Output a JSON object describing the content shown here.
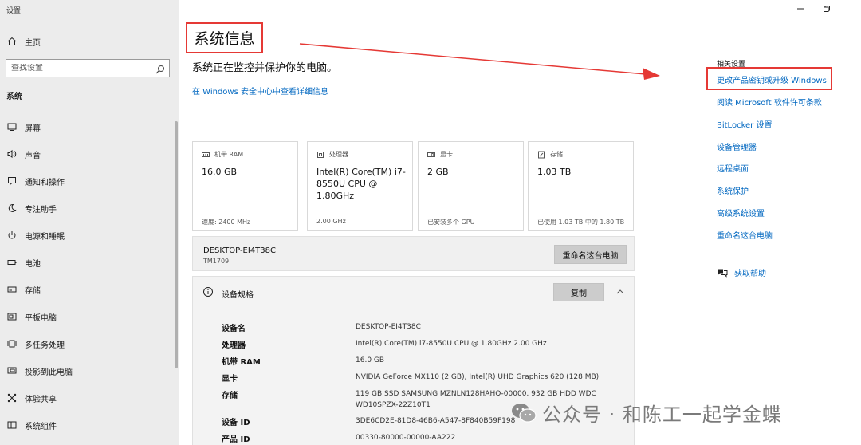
{
  "window": {
    "app_title": "设置",
    "controls": {
      "minimize": "minimize-icon",
      "restore": "restore-icon"
    }
  },
  "sidebar": {
    "home_label": "主页",
    "search_placeholder": "查找设置",
    "section_label": "系统",
    "items": [
      {
        "label": "屏幕",
        "icon": "display-icon"
      },
      {
        "label": "声音",
        "icon": "speaker-icon"
      },
      {
        "label": "通知和操作",
        "icon": "notification-icon"
      },
      {
        "label": "专注助手",
        "icon": "moon-icon"
      },
      {
        "label": "电源和睡眠",
        "icon": "power-icon"
      },
      {
        "label": "电池",
        "icon": "battery-icon"
      },
      {
        "label": "存储",
        "icon": "storage-icon"
      },
      {
        "label": "平板电脑",
        "icon": "tablet-icon"
      },
      {
        "label": "多任务处理",
        "icon": "multitask-icon"
      },
      {
        "label": "投影到此电脑",
        "icon": "project-icon"
      },
      {
        "label": "体验共享",
        "icon": "share-icon"
      },
      {
        "label": "系统组件",
        "icon": "components-icon"
      }
    ]
  },
  "main": {
    "title": "系统信息",
    "subtitle": "系统正在监控并保护你的电脑。",
    "defender_link": "在 Windows 安全中心中查看详细信息",
    "tiles": [
      {
        "label": "机带 RAM",
        "value": "16.0 GB",
        "detail": "速度: 2400 MHz",
        "icon": "ram-icon"
      },
      {
        "label": "处理器",
        "value": "Intel(R) Core(TM) i7-8550U CPU @ 1.80GHz",
        "detail": "2.00 GHz",
        "icon": "cpu-icon"
      },
      {
        "label": "显卡",
        "value": "2 GB",
        "detail": "已安装多个 GPU",
        "icon": "gpu-icon"
      },
      {
        "label": "存储",
        "value": "1.03 TB",
        "detail": "已使用 1.03 TB 中的 1.80 TB",
        "icon": "storage-icon"
      }
    ],
    "device_bar": {
      "hostname": "DESKTOP-EI4T38C",
      "model": "TM1709",
      "rename_button": "重命名这台电脑"
    },
    "specs": {
      "title": "设备规格",
      "copy_button": "复制",
      "rows": [
        {
          "key": "设备名",
          "value": "DESKTOP-EI4T38C"
        },
        {
          "key": "处理器",
          "value": "Intel(R) Core(TM) i7-8550U CPU @ 1.80GHz   2.00 GHz"
        },
        {
          "key": "机带 RAM",
          "value": "16.0 GB"
        },
        {
          "key": "显卡",
          "value": "NVIDIA GeForce MX110 (2 GB), Intel(R) UHD Graphics 620 (128 MB)"
        },
        {
          "key": "存储",
          "value": "119 GB SSD SAMSUNG MZNLN128HAHQ-00000, 932 GB HDD WDC WD10SPZX-22Z10T1"
        },
        {
          "key": "设备 ID",
          "value": "3DE6CD2E-81D8-46B6-A547-8F840B59F198"
        },
        {
          "key": "产品 ID",
          "value": "00330-80000-00000-AA222"
        }
      ]
    }
  },
  "related": {
    "header": "相关设置",
    "links": [
      "更改产品密钥或升级 Windows",
      "阅读 Microsoft 软件许可条款",
      "BitLocker 设置",
      "设备管理器",
      "远程桌面",
      "系统保护",
      "高级系统设置",
      "重命名这台电脑"
    ],
    "help_label": "获取帮助"
  },
  "annotation": {
    "highlight_color": "#e53935"
  },
  "watermark": {
    "text": "公众号 · 和陈工一起学金蝶"
  },
  "colors": {
    "accent": "#0067c0",
    "sidebar_bg": "#ececec",
    "panel_bg": "#f3f3f3"
  }
}
